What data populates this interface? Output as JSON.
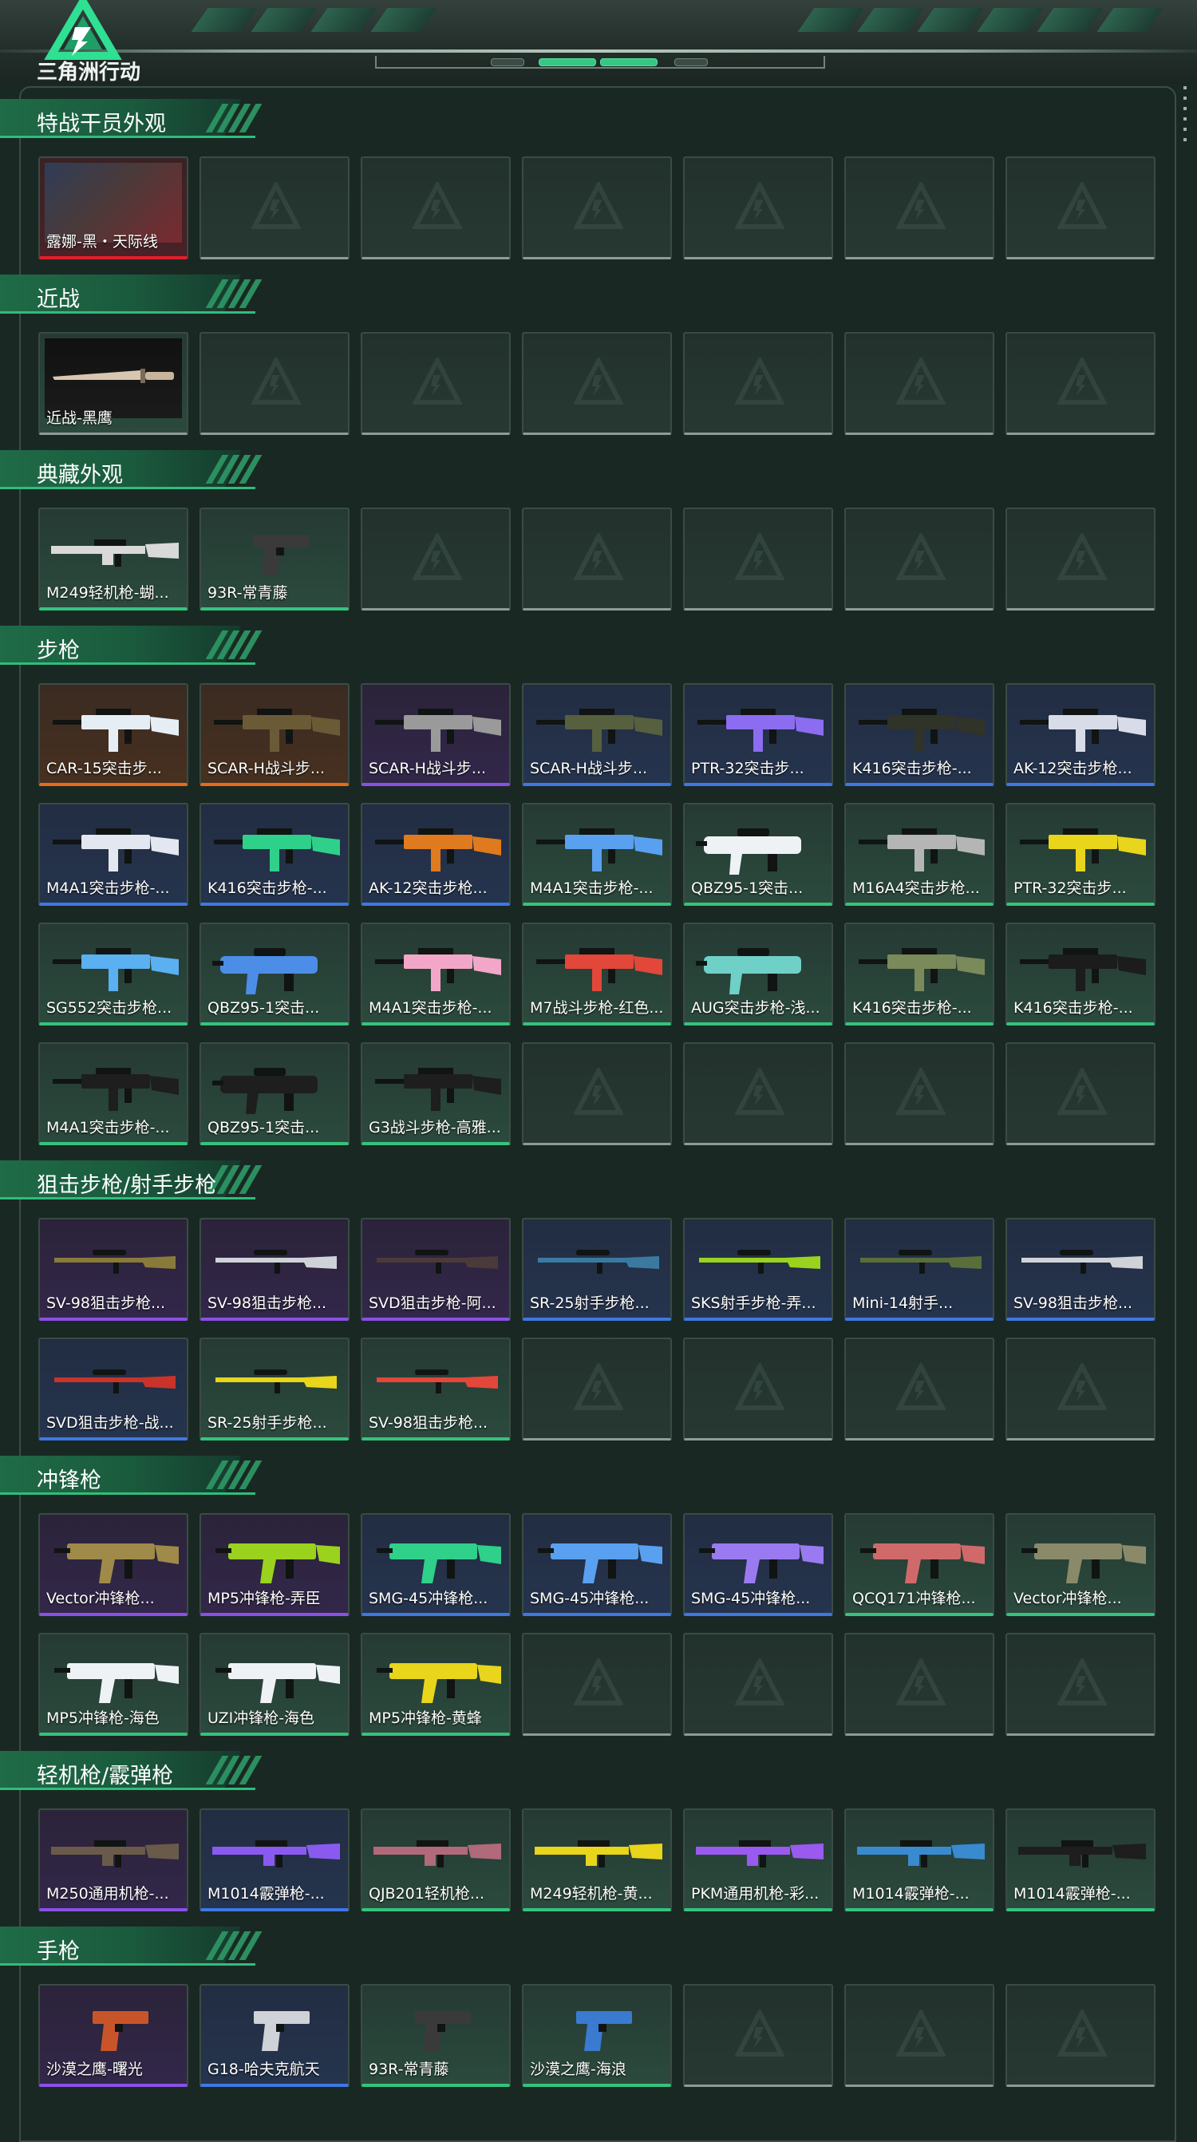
{
  "header": {
    "logo_text": "三角洲行动"
  },
  "colors": {
    "accent": "#2fbd7c",
    "quality_green": "#35c37d",
    "quality_blue": "#3e78e3",
    "quality_purple": "#8a50e6",
    "quality_orange": "#e86b1a",
    "quality_red": "#e0202a"
  },
  "sections": [
    {
      "title": "特战干员外观",
      "items": [
        {
          "name": "露娜-黑・天际线",
          "quality": "red",
          "kind": "operator"
        }
      ]
    },
    {
      "title": "近战",
      "items": [
        {
          "name": "近战-黑鹰",
          "quality": "none",
          "kind": "knife"
        }
      ]
    },
    {
      "title": "典藏外观",
      "items": [
        {
          "name": "M249轻机枪-蝴...",
          "quality": "green",
          "kind": "lmg",
          "color": "#d9d9d9"
        },
        {
          "name": "93R-常青藤",
          "quality": "green",
          "kind": "pistol",
          "color": "#3a3a3a"
        }
      ]
    },
    {
      "title": "步枪",
      "items": [
        {
          "name": "CAR-15突击步...",
          "quality": "orange",
          "kind": "rifle",
          "color": "#e6eef5"
        },
        {
          "name": "SCAR-H战斗步...",
          "quality": "orange",
          "kind": "rifle",
          "color": "#6b5a36"
        },
        {
          "name": "SCAR-H战斗步...",
          "quality": "purple",
          "kind": "rifle",
          "color": "#9a9a9a"
        },
        {
          "name": "SCAR-H战斗步...",
          "quality": "blue",
          "kind": "rifle",
          "color": "#56603f"
        },
        {
          "name": "PTR-32突击步...",
          "quality": "blue",
          "kind": "rifle",
          "color": "#8c6cf0"
        },
        {
          "name": "K416突击步枪-...",
          "quality": "blue",
          "kind": "rifle",
          "color": "#2f3328"
        },
        {
          "name": "AK-12突击步枪...",
          "quality": "blue",
          "kind": "rifle",
          "color": "#d7dce8"
        },
        {
          "name": "M4A1突击步枪-...",
          "quality": "blue",
          "kind": "rifle",
          "color": "#e3e8f0"
        },
        {
          "name": "K416突击步枪-...",
          "quality": "blue",
          "kind": "rifle",
          "color": "#2fd08a"
        },
        {
          "name": "AK-12突击步枪...",
          "quality": "blue",
          "kind": "rifle",
          "color": "#e07a1e"
        },
        {
          "name": "M4A1突击步枪-...",
          "quality": "green",
          "kind": "rifle",
          "color": "#5aa0f0"
        },
        {
          "name": "QBZ95-1突击...",
          "quality": "green",
          "kind": "bullpup",
          "color": "#eef2f5"
        },
        {
          "name": "M16A4突击步枪...",
          "quality": "green",
          "kind": "rifle",
          "color": "#b5b5b5"
        },
        {
          "name": "PTR-32突击步...",
          "quality": "green",
          "kind": "rifle",
          "color": "#e8d51c"
        },
        {
          "name": "SG552突击步枪...",
          "quality": "green",
          "kind": "rifle",
          "color": "#5ab0f0"
        },
        {
          "name": "QBZ95-1突击...",
          "quality": "green",
          "kind": "bullpup",
          "color": "#4c8de8"
        },
        {
          "name": "M4A1突击步枪-...",
          "quality": "green",
          "kind": "rifle",
          "color": "#f2a7c8"
        },
        {
          "name": "M7战斗步枪-红色...",
          "quality": "green",
          "kind": "rifle",
          "color": "#e2473a"
        },
        {
          "name": "AUG突击步枪-浅...",
          "quality": "green",
          "kind": "bullpup",
          "color": "#6fd0c8"
        },
        {
          "name": "K416突击步枪-...",
          "quality": "green",
          "kind": "rifle",
          "color": "#7a8a5a"
        },
        {
          "name": "K416突击步枪-...",
          "quality": "green",
          "kind": "rifle",
          "color": "#1c1c1c"
        },
        {
          "name": "M4A1突击步枪-...",
          "quality": "green",
          "kind": "rifle",
          "color": "#1e1e1e"
        },
        {
          "name": "QBZ95-1突击...",
          "quality": "green",
          "kind": "bullpup",
          "color": "#1e1e1e"
        },
        {
          "name": "G3战斗步枪-高雅...",
          "quality": "green",
          "kind": "rifle",
          "color": "#1e1e1e"
        }
      ]
    },
    {
      "title": "狙击步枪/射手步枪",
      "items": [
        {
          "name": "SV-98狙击步枪...",
          "quality": "purple",
          "kind": "sniper",
          "color": "#8a7a3a"
        },
        {
          "name": "SV-98狙击步枪...",
          "quality": "purple",
          "kind": "sniper",
          "color": "#cfd3d8"
        },
        {
          "name": "SVD狙击步枪-阿...",
          "quality": "purple",
          "kind": "sniper",
          "color": "#4a3a3a"
        },
        {
          "name": "SR-25射手步枪...",
          "quality": "blue",
          "kind": "sniper",
          "color": "#3a7aa0"
        },
        {
          "name": "SKS射手步枪-弄...",
          "quality": "blue",
          "kind": "sniper",
          "color": "#9ad21e"
        },
        {
          "name": "Mini-14射手...",
          "quality": "blue",
          "kind": "sniper",
          "color": "#5a6e3a"
        },
        {
          "name": "SV-98狙击步枪...",
          "quality": "blue",
          "kind": "sniper",
          "color": "#cfd3d8"
        },
        {
          "name": "SVD狙击步枪-战...",
          "quality": "blue",
          "kind": "sniper",
          "color": "#c8332a"
        },
        {
          "name": "SR-25射手步枪...",
          "quality": "green",
          "kind": "sniper",
          "color": "#e8d51c"
        },
        {
          "name": "SV-98狙击步枪...",
          "quality": "green",
          "kind": "sniper",
          "color": "#e2473a"
        }
      ]
    },
    {
      "title": "冲锋枪",
      "items": [
        {
          "name": "Vector冲锋枪...",
          "quality": "purple",
          "kind": "smg",
          "color": "#a08a4a"
        },
        {
          "name": "MP5冲锋枪-弄臣",
          "quality": "purple",
          "kind": "smg",
          "color": "#9ad21e"
        },
        {
          "name": "SMG-45冲锋枪...",
          "quality": "blue",
          "kind": "smg",
          "color": "#2fd08a"
        },
        {
          "name": "SMG-45冲锋枪...",
          "quality": "blue",
          "kind": "smg",
          "color": "#5aa0f0"
        },
        {
          "name": "SMG-45冲锋枪...",
          "quality": "blue",
          "kind": "smg",
          "color": "#9a7af0"
        },
        {
          "name": "QCQ171冲锋枪...",
          "quality": "green",
          "kind": "smg",
          "color": "#d06a6a"
        },
        {
          "name": "Vector冲锋枪...",
          "quality": "green",
          "kind": "smg",
          "color": "#8a8a6a"
        },
        {
          "name": "MP5冲锋枪-海色",
          "quality": "green",
          "kind": "smg",
          "color": "#eef2f5"
        },
        {
          "name": "UZI冲锋枪-海色",
          "quality": "green",
          "kind": "smg",
          "color": "#eef2f5"
        },
        {
          "name": "MP5冲锋枪-黄蜂",
          "quality": "green",
          "kind": "smg",
          "color": "#e8d51c"
        }
      ]
    },
    {
      "title": "轻机枪/霰弹枪",
      "items": [
        {
          "name": "M250通用机枪-...",
          "quality": "purple",
          "kind": "lmg",
          "color": "#6a5a4a"
        },
        {
          "name": "M1014霰弹枪-...",
          "quality": "blue",
          "kind": "shotgun",
          "color": "#8a5af0"
        },
        {
          "name": "QJB201轻机枪...",
          "quality": "green",
          "kind": "lmg",
          "color": "#b06a7a"
        },
        {
          "name": "M249轻机枪-黄...",
          "quality": "green",
          "kind": "lmg",
          "color": "#e8d51c"
        },
        {
          "name": "PKM通用机枪-彩...",
          "quality": "green",
          "kind": "lmg",
          "color": "#9a5af0"
        },
        {
          "name": "M1014霰弹枪-...",
          "quality": "green",
          "kind": "shotgun",
          "color": "#3a8ad0"
        },
        {
          "name": "M1014霰弹枪-...",
          "quality": "green",
          "kind": "shotgun",
          "color": "#1e1e1e"
        }
      ]
    },
    {
      "title": "手枪",
      "items": [
        {
          "name": "沙漠之鹰-曙光",
          "quality": "purple",
          "kind": "pistol",
          "color": "#c8552a"
        },
        {
          "name": "G18-哈夫克航天",
          "quality": "blue",
          "kind": "pistol",
          "color": "#cfd3d8"
        },
        {
          "name": "93R-常青藤",
          "quality": "green",
          "kind": "pistol",
          "color": "#3a3a3a"
        },
        {
          "name": "沙漠之鹰-海浪",
          "quality": "green",
          "kind": "pistol",
          "color": "#3a7ad0"
        }
      ]
    }
  ]
}
